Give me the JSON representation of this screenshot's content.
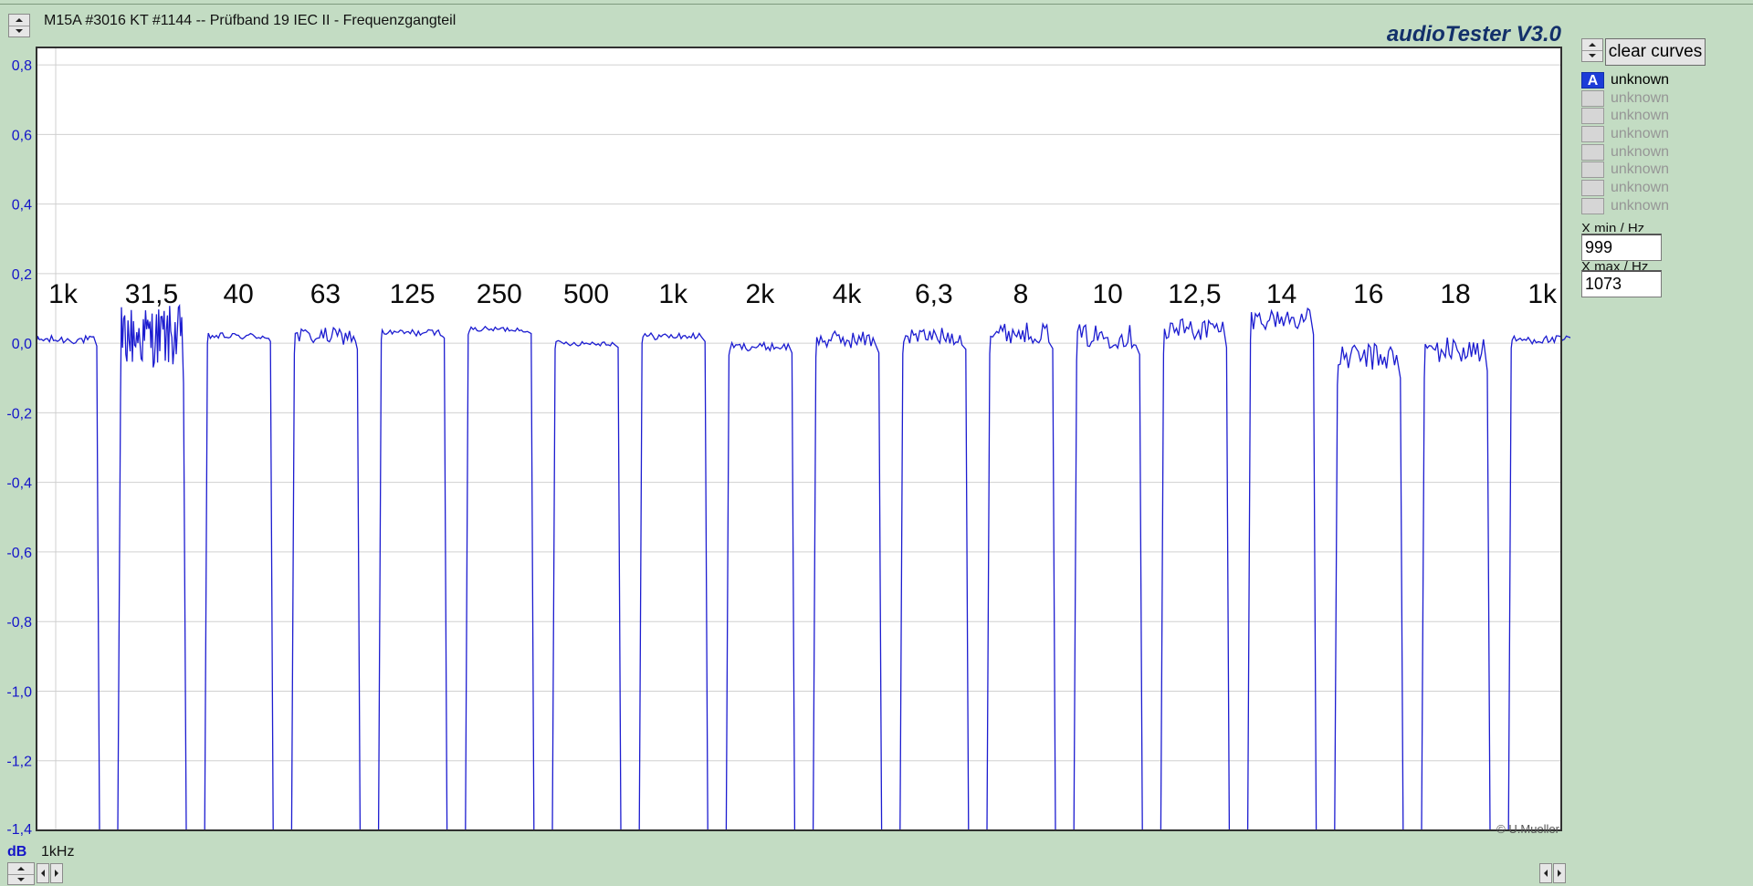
{
  "window": {
    "title": "M15A #3016 KT #1144 -- Prüfband 19 IEC II - Frequenzgangteil",
    "brand": "audioTester  V3.0"
  },
  "chart_data": {
    "type": "line",
    "title": "",
    "xlabel": "1kHz",
    "ylabel": "dB",
    "ylim": [
      -1.4,
      0.85
    ],
    "y_ticks": [
      "0,8",
      "0,6",
      "0,4",
      "0,2",
      "0,0",
      "-0,2",
      "-0,4",
      "-0,6",
      "-0,8",
      "-1,0",
      "-1,2",
      "-1,4"
    ],
    "y_tick_values": [
      0.8,
      0.6,
      0.4,
      0.2,
      0.0,
      -0.2,
      -0.4,
      -0.6,
      -0.8,
      -1.0,
      -1.2,
      -1.4
    ],
    "grid": true,
    "line_color": "#1c1cd0",
    "segment_labels": [
      "1k",
      "31,5",
      "40",
      "63",
      "125",
      "250",
      "500",
      "1k",
      "2k",
      "4k",
      "6,3",
      "8",
      "10",
      "12,5",
      "14",
      "16",
      "18",
      "1k"
    ],
    "series": [
      {
        "segment_levels_db": [
          0.01,
          0.02,
          0.02,
          0.02,
          0.03,
          0.04,
          0.0,
          0.02,
          -0.01,
          0.01,
          0.02,
          0.03,
          0.02,
          0.04,
          0.07,
          -0.04,
          -0.02,
          0.01
        ],
        "segment_ripple_db": [
          0.012,
          0.09,
          0.01,
          0.025,
          0.01,
          0.008,
          0.008,
          0.01,
          0.012,
          0.025,
          0.025,
          0.03,
          0.035,
          0.035,
          0.03,
          0.04,
          0.04,
          0.012
        ],
        "gap_level_db": -1.4
      }
    ],
    "copyright": "© U.Mueller"
  },
  "sidebar": {
    "clear_button": "clear curves",
    "curves": [
      {
        "label": "A",
        "name": "unknown",
        "active": true
      },
      {
        "label": "",
        "name": "unknown",
        "active": false
      },
      {
        "label": "",
        "name": "unknown",
        "active": false
      },
      {
        "label": "",
        "name": "unknown",
        "active": false
      },
      {
        "label": "",
        "name": "unknown",
        "active": false
      },
      {
        "label": "",
        "name": "unknown",
        "active": false
      },
      {
        "label": "",
        "name": "unknown",
        "active": false
      },
      {
        "label": "",
        "name": "unknown",
        "active": false
      }
    ],
    "xmin_label": "X min / Hz",
    "xmin_value": "999",
    "xmax_label": "X max / Hz",
    "xmax_value": "1073"
  },
  "bottom": {
    "y_unit": "dB",
    "x_unit": "1kHz"
  }
}
